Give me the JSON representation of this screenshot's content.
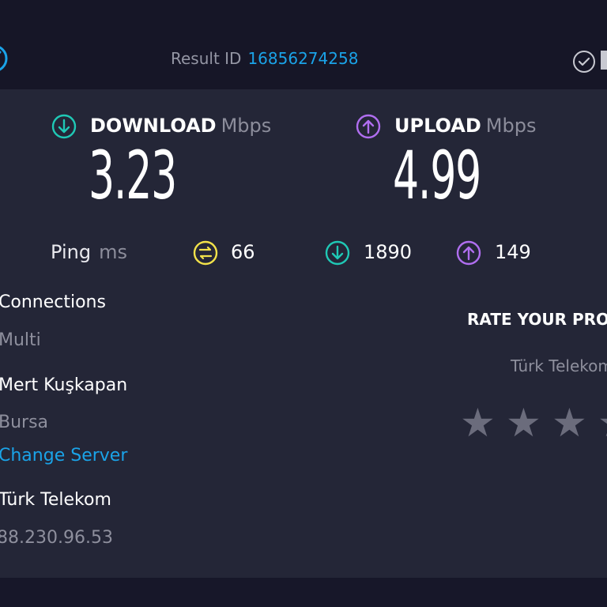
{
  "header": {
    "result_label": "Result ID",
    "result_id": "16856274258",
    "left_icon": "speed-gauge-icon",
    "right_icon": "check-circle-icon"
  },
  "download": {
    "label": "DOWNLOAD",
    "unit": "Mbps",
    "value": "3.23",
    "icon": "download-arrow-icon",
    "color": "#1fc8b5"
  },
  "upload": {
    "label": "UPLOAD",
    "unit": "Mbps",
    "value": "4.99",
    "icon": "upload-arrow-icon",
    "color": "#b06ef0"
  },
  "ping": {
    "label": "Ping",
    "unit": "ms",
    "idle_value": "66",
    "download_value": "1890",
    "upload_value": "149",
    "idle_color": "#f2e24a"
  },
  "connections": {
    "title": "Connections",
    "mode": "Multi"
  },
  "server": {
    "name": "Mert Kuşkapan",
    "location": "Bursa",
    "change_label": "Change Server"
  },
  "isp": {
    "name": "Türk Telekom",
    "ip": "88.230.96.53"
  },
  "rating": {
    "title": "RATE YOUR PRO",
    "provider": "Türk Telekom",
    "star_glyph": "★",
    "star_color": "#6b6c7c"
  },
  "colors": {
    "accent_link": "#1aa3e8",
    "panel_bg": "#242637",
    "top_bg": "#161627"
  }
}
